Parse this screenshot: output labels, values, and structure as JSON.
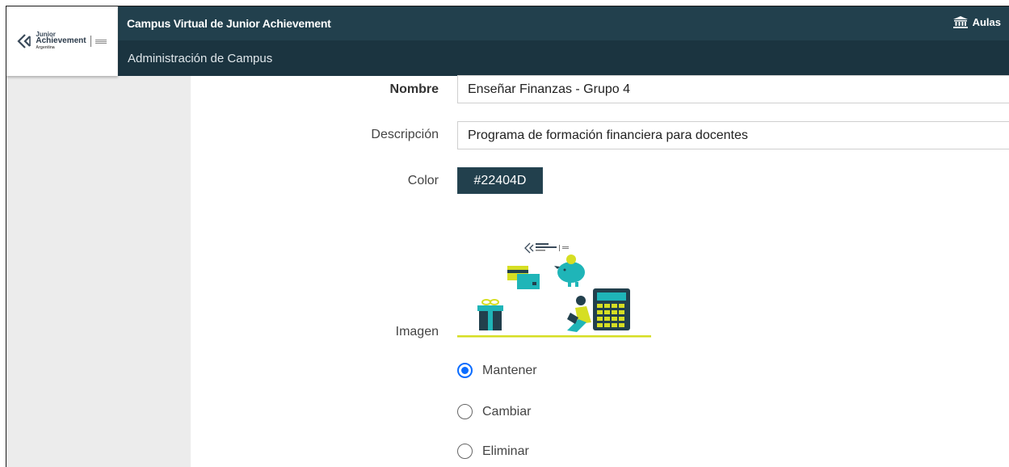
{
  "header": {
    "logo": {
      "line1": "Junior",
      "line2": "Achievement",
      "line3": "Argentina"
    },
    "app_title": "Campus Virtual de Junior Achievement",
    "aulas_label": "Aulas",
    "aulas_icon": "building-columns-icon",
    "subtitle": "Administración de Campus",
    "bar_color": "#22404d"
  },
  "form": {
    "nombre": {
      "label": "Nombre",
      "value": "Enseñar Finanzas - Grupo 4"
    },
    "descripcion": {
      "label": "Descripción",
      "value": "Programa de formación financiera para docentes"
    },
    "color": {
      "label": "Color",
      "value": "#22404D"
    },
    "imagen": {
      "label": "Imagen",
      "logo_text": "Junior Achievement Argentina",
      "options": [
        {
          "label": "Mantener",
          "checked": true
        },
        {
          "label": "Cambiar",
          "checked": false
        },
        {
          "label": "Eliminar",
          "checked": false
        }
      ]
    }
  },
  "colors": {
    "accent_teal": "#1fb5b8",
    "accent_yellow": "#d6de23",
    "dark": "#22404d",
    "radio_blue": "#0a6cff"
  }
}
